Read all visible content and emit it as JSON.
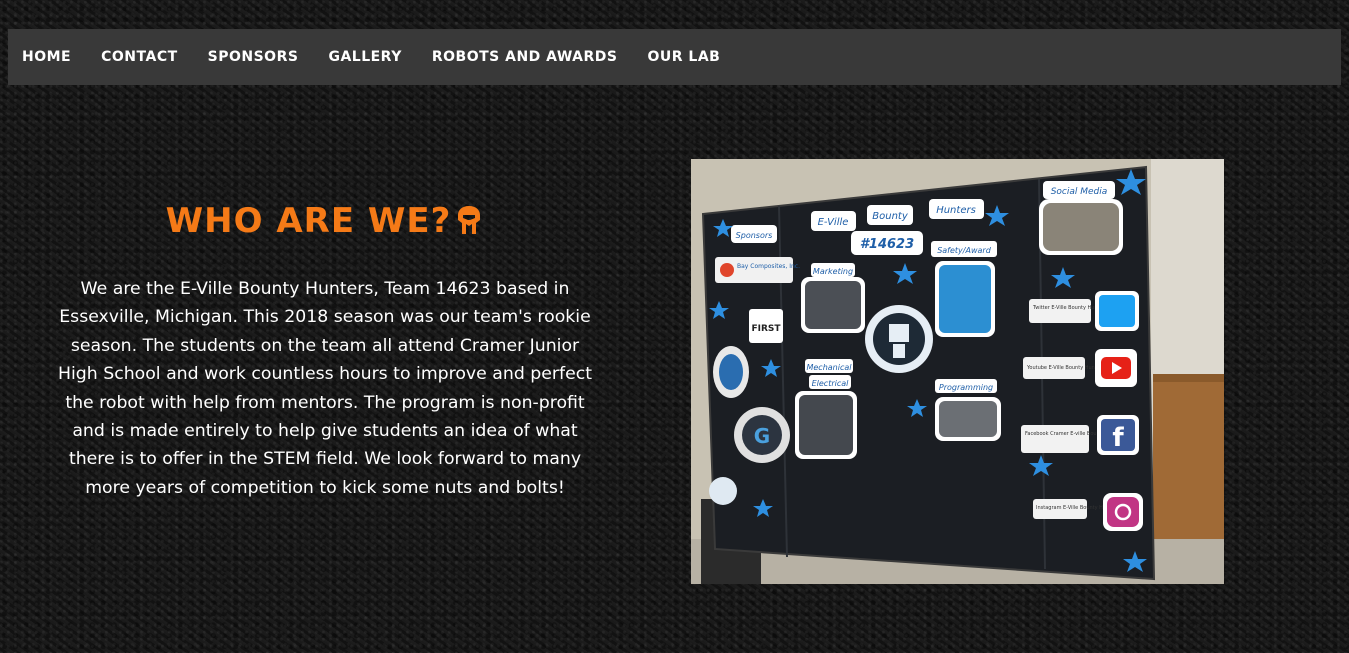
{
  "nav": {
    "items": [
      {
        "label": "HOME"
      },
      {
        "label": "CONTACT"
      },
      {
        "label": "SPONSORS"
      },
      {
        "label": "GALLERY"
      },
      {
        "label": "ROBOTS AND AWARDS"
      },
      {
        "label": "OUR LAB"
      }
    ]
  },
  "about": {
    "heading": "WHO ARE WE?",
    "heading_icon": "mandalorian-emblem-icon",
    "description": "We are the E-Ville Bounty Hunters, Team 14623 based in Essexville, Michigan. This 2018 season was our team's rookie season. The students on the team all attend Cramer Junior High School and work countless hours to improve and perfect the robot with help from mentors. The program is non-profit and is made entirely to help give students an idea of what there is to offer in the STEM field. We look forward to many more years of competition to kick some nuts and bolts!"
  },
  "photo": {
    "board_title_1": "E-Ville",
    "board_title_2": "Bounty",
    "board_title_3": "Hunters",
    "board_team_number": "#14623",
    "sponsors_label": "Sponsors",
    "sponsor_name": "Bay Composites, Inc.",
    "first_logo": "FIRST",
    "marketing_label": "Marketing",
    "mechanical_label": "Mechanical",
    "electrical_label": "Electrical",
    "safety_label": "Safety/Award",
    "programming_label": "Programming",
    "social_label": "Social Media",
    "twitter_text": "Twitter E-Ville Bounty Hunters",
    "youtube_text": "Youtube E-Ville Bounty Hunters",
    "facebook_text": "Facebook Cramer E-ville Bounty-Hunters",
    "instagram_text": "Instagram E-Ville Bounty Hunters",
    "badge_letter": "G"
  },
  "colors": {
    "heading": "#f57a17",
    "nav_bg": "#393939",
    "text": "#ffffff"
  }
}
